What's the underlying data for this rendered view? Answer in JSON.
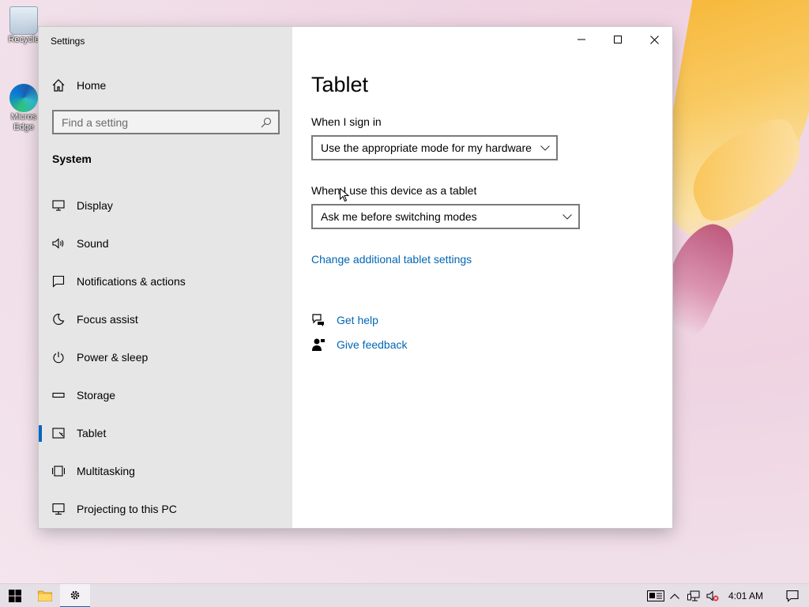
{
  "desktop": {
    "icons": [
      {
        "label": "Recycle"
      },
      {
        "label": "Micros Edge"
      }
    ]
  },
  "window": {
    "title": "Settings",
    "controls": {
      "minimize": "minimize",
      "maximize": "maximize",
      "close": "close"
    }
  },
  "sidebar": {
    "home_label": "Home",
    "search_placeholder": "Find a setting",
    "section": "System",
    "items": [
      {
        "label": "Display",
        "icon": "display-icon"
      },
      {
        "label": "Sound",
        "icon": "sound-icon"
      },
      {
        "label": "Notifications & actions",
        "icon": "notifications-icon"
      },
      {
        "label": "Focus assist",
        "icon": "moon-icon"
      },
      {
        "label": "Power & sleep",
        "icon": "power-icon"
      },
      {
        "label": "Storage",
        "icon": "storage-icon"
      },
      {
        "label": "Tablet",
        "icon": "tablet-icon",
        "selected": true
      },
      {
        "label": "Multitasking",
        "icon": "multitasking-icon"
      },
      {
        "label": "Projecting to this PC",
        "icon": "projecting-icon"
      }
    ]
  },
  "main": {
    "title": "Tablet",
    "sign_in_label": "When I sign in",
    "sign_in_value": "Use the appropriate mode for my hardware",
    "tablet_use_label": "When I use this device as a tablet",
    "tablet_use_value": "Ask me before switching modes",
    "additional_link": "Change additional tablet settings",
    "get_help": "Get help",
    "give_feedback": "Give feedback"
  },
  "taskbar": {
    "clock": "4:01 AM"
  },
  "colors": {
    "accent": "#0067c0",
    "link": "#0066b4",
    "sidebar_bg": "#e6e6e6"
  }
}
